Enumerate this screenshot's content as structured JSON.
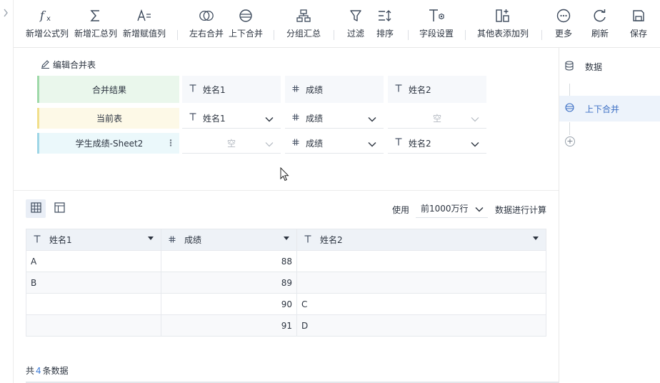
{
  "toolbar": {
    "items": [
      {
        "label": "新增公式列",
        "icon": "formula-fx-icon"
      },
      {
        "label": "新增汇总列",
        "icon": "sigma-sum-icon"
      },
      {
        "label": "新增赋值列",
        "icon": "assign-value-icon"
      },
      {
        "label": "左右合并",
        "icon": "venn-merge-icon"
      },
      {
        "label": "上下合并",
        "icon": "union-stack-icon"
      },
      {
        "label": "分组汇总",
        "icon": "group-tree-icon"
      },
      {
        "label": "过滤",
        "icon": "funnel-filter-icon"
      },
      {
        "label": "排序",
        "icon": "sort-icon"
      },
      {
        "label": "字段设置",
        "icon": "field-settings-icon"
      },
      {
        "label": "其他表添加列",
        "icon": "add-column-icon"
      },
      {
        "label": "更多",
        "icon": "more-dots-icon"
      },
      {
        "label": "刷新",
        "icon": "refresh-icon"
      },
      {
        "label": "保存",
        "icon": "save-icon"
      }
    ]
  },
  "editor": {
    "edit_link": "编辑合并表",
    "rows": [
      {
        "source": "合并结果",
        "cells": [
          {
            "type": "text",
            "label": "姓名1"
          },
          {
            "type": "number",
            "label": "成绩"
          },
          {
            "type": "text",
            "label": "姓名2"
          }
        ]
      },
      {
        "source": "当前表",
        "cells": [
          {
            "type": "text",
            "label": "姓名1"
          },
          {
            "type": "number",
            "label": "成绩"
          },
          {
            "type": "empty",
            "label": "空"
          }
        ]
      },
      {
        "source": "学生成绩-Sheet2",
        "cells": [
          {
            "type": "empty",
            "label": "空"
          },
          {
            "type": "number",
            "label": "成绩"
          },
          {
            "type": "text",
            "label": "姓名2"
          }
        ]
      }
    ]
  },
  "preview": {
    "use_label": "使用",
    "rows_option": "前1000万行",
    "calc_label": "数据进行计算",
    "columns": [
      {
        "type": "text",
        "label": "姓名1"
      },
      {
        "type": "number",
        "label": "成绩"
      },
      {
        "type": "text",
        "label": "姓名2"
      }
    ],
    "rows": [
      [
        "A",
        "88",
        ""
      ],
      [
        "B",
        "89",
        ""
      ],
      [
        "",
        "90",
        "C"
      ],
      [
        "",
        "91",
        "D"
      ]
    ],
    "total_prefix": "共",
    "total_count": "4",
    "total_suffix": "条数据"
  },
  "right_panel": {
    "items": [
      {
        "label": "数据",
        "icon": "database-icon"
      },
      {
        "label": "上下合并",
        "icon": "union-stack-icon"
      }
    ],
    "add_label": "+"
  },
  "colors": {
    "accent": "#3c6fc4",
    "result_row": "#eaf7ec",
    "current_row": "#fdf9e7",
    "other_row": "#ebf8fb"
  }
}
